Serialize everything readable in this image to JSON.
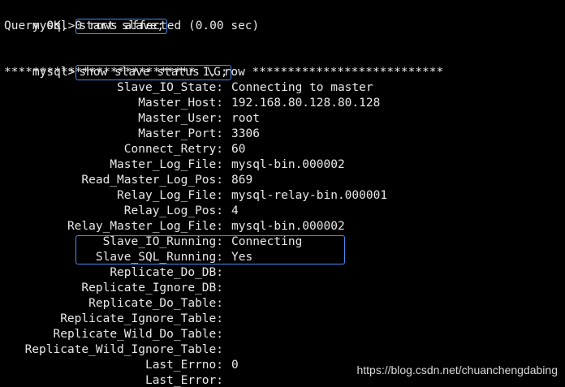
{
  "terminal": {
    "prompt": "mysql>",
    "cmd1": "start slave;",
    "result1": "Query OK, 0 rows affected (0.00 sec)",
    "cmd2": "show slave status \\G;",
    "row_header": "*************************** 1. row ***************************"
  },
  "fields": [
    {
      "key": "Slave_IO_State:",
      "value": "Connecting to master"
    },
    {
      "key": "Master_Host:",
      "value": "192.168.80.128.80.128"
    },
    {
      "key": "Master_User:",
      "value": "root"
    },
    {
      "key": "Master_Port:",
      "value": "3306"
    },
    {
      "key": "Connect_Retry:",
      "value": "60"
    },
    {
      "key": "Master_Log_File:",
      "value": "mysql-bin.000002"
    },
    {
      "key": "Read_Master_Log_Pos:",
      "value": "869"
    },
    {
      "key": "Relay_Log_File:",
      "value": "mysql-relay-bin.000001"
    },
    {
      "key": "Relay_Log_Pos:",
      "value": "4"
    },
    {
      "key": "Relay_Master_Log_File:",
      "value": "mysql-bin.000002"
    },
    {
      "key": "Slave_IO_Running:",
      "value": "Connecting"
    },
    {
      "key": "Slave_SQL_Running:",
      "value": "Yes"
    },
    {
      "key": "Replicate_Do_DB:",
      "value": ""
    },
    {
      "key": "Replicate_Ignore_DB:",
      "value": ""
    },
    {
      "key": "Replicate_Do_Table:",
      "value": ""
    },
    {
      "key": "Replicate_Ignore_Table:",
      "value": ""
    },
    {
      "key": "Replicate_Wild_Do_Table:",
      "value": ""
    },
    {
      "key": "Replicate_Wild_Ignore_Table:",
      "value": ""
    },
    {
      "key": "Last_Errno:",
      "value": "0"
    },
    {
      "key": "Last_Error:",
      "value": ""
    }
  ],
  "watermark": "https://blog.csdn.net/chuanchengdabing",
  "colors": {
    "background": "#000000",
    "text": "#e8e8e8",
    "highlight_border": "#4b8cf0"
  }
}
